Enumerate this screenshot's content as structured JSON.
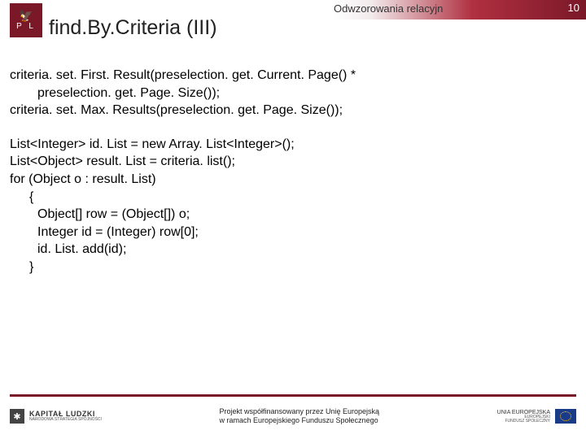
{
  "header": {
    "breadcrumb": "Odwzorowania relacyjn",
    "page_number": "10"
  },
  "logo": {
    "symbol": "🦅",
    "initials": "P   L"
  },
  "title": "find.By.Criteria (III)",
  "code": {
    "l1": "criteria. set. First. Result(preselection. get. Current. Page() *",
    "l2": "preselection. get. Page. Size());",
    "l3": "criteria. set. Max. Results(preselection. get. Page. Size());",
    "l4": "List<Integer> id. List = new Array. List<Integer>();",
    "l5": "List<Object> result. List = criteria. list();",
    "l6": "for (Object o : result. List)",
    "l7": "{",
    "l8": "Object[] row = (Object[]) o;",
    "l9": "Integer id = (Integer) row[0];",
    "l10": "id. List. add(id);",
    "l11": "}"
  },
  "footer": {
    "kl_symbol": "✱",
    "kl_title": "KAPITAŁ LUDZKI",
    "kl_sub": "NARODOWA STRATEGIA SPÓJNOŚCI",
    "center1": "Projekt współfinansowany przez Unię Europejską",
    "center2": "w ramach Europejskiego Funduszu Społecznego",
    "ue_l1": "UNIA EUROPEJSKA",
    "ue_l2": "EUROPEJSKI",
    "ue_l3": "FUNDUSZ SPOŁECZNY"
  }
}
